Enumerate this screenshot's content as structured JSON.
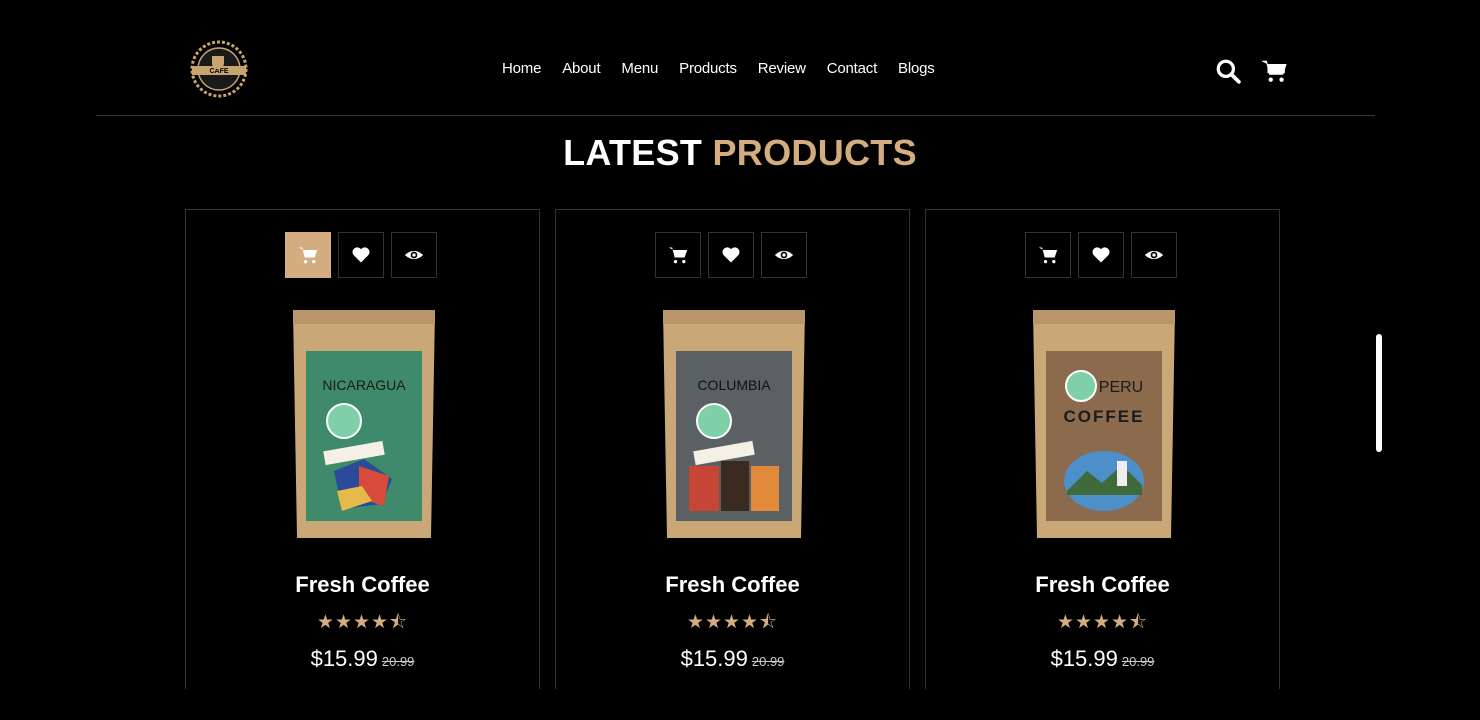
{
  "header": {
    "logo_icon": "cafe-logo-icon",
    "nav": [
      "Home",
      "About",
      "Menu",
      "Products",
      "Review",
      "Contact",
      "Blogs"
    ],
    "icons": [
      "search-icon",
      "cart-icon"
    ]
  },
  "section": {
    "heading_main": "LATEST",
    "heading_accent": "PRODUCTS",
    "accent_color": "#d3ad7f"
  },
  "products": [
    {
      "action_icons": [
        "cart-icon",
        "heart-icon",
        "eye-icon"
      ],
      "bag_label": "NICARAGUA",
      "name": "Fresh Coffee",
      "rating": "4.5 / 5",
      "stars": "★★★★⯪",
      "price": "$15.99",
      "old_price": "20.99"
    },
    {
      "action_icons": [
        "cart-icon",
        "heart-icon",
        "eye-icon"
      ],
      "bag_label": "COLUMBIA",
      "name": "Fresh Coffee",
      "rating": "4.5 / 5",
      "stars": "★★★★⯪",
      "price": "$15.99",
      "old_price": "20.99"
    },
    {
      "action_icons": [
        "cart-icon",
        "heart-icon",
        "eye-icon"
      ],
      "bag_label": "PERU",
      "bag_sub": "COFFEE",
      "name": "Fresh Coffee",
      "rating": "4.5 / 5",
      "stars": "★★★★⯪",
      "price": "$15.99",
      "old_price": "20.99"
    }
  ]
}
